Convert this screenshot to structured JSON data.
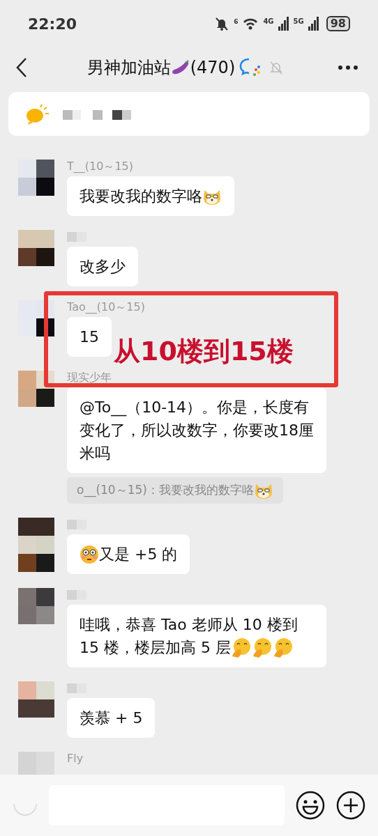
{
  "status_bar": {
    "time": "22:20",
    "wifi_label": "6",
    "net1": "4G",
    "net2": "5G",
    "battery": "98"
  },
  "header": {
    "title": "男神加油站",
    "count": "(470)"
  },
  "messages": [
    {
      "sender": "T__(10～15)",
      "parts": [
        {
          "kind": "text",
          "text": "我要改我的数字咯"
        },
        {
          "kind": "doge"
        }
      ]
    },
    {
      "parts": [
        {
          "kind": "text",
          "text": "改多少"
        }
      ]
    },
    {
      "sender": "Tao__(10～15)",
      "parts": [
        {
          "kind": "text",
          "text": "15"
        }
      ]
    },
    {
      "sender": "现实少年",
      "parts": [
        {
          "kind": "text",
          "text": "@To__（10-14）。你是，长度有变化了，所以改数字，你要改18厘米吗"
        }
      ],
      "quote": {
        "parts": [
          {
            "kind": "text",
            "text": "o__(10～15)：我要改我的数字咯"
          },
          {
            "kind": "doge"
          }
        ]
      }
    },
    {
      "parts": [
        {
          "kind": "flushed"
        },
        {
          "kind": "text",
          "text": "又是 +5 的"
        }
      ]
    },
    {
      "parts": [
        {
          "kind": "text",
          "text": "哇哦，恭喜 Tao 老师从 10 楼到"
        },
        {
          "kind": "text",
          "text": "15 楼，楼层加高 5 层"
        },
        {
          "kind": "smirk"
        },
        {
          "kind": "smirk"
        },
        {
          "kind": "smirk"
        }
      ]
    },
    {
      "parts": [
        {
          "kind": "text",
          "text": "羡慕 + 5"
        }
      ]
    },
    {
      "sender": "Fly"
    }
  ],
  "annotation": {
    "text": "从10楼到15楼"
  }
}
